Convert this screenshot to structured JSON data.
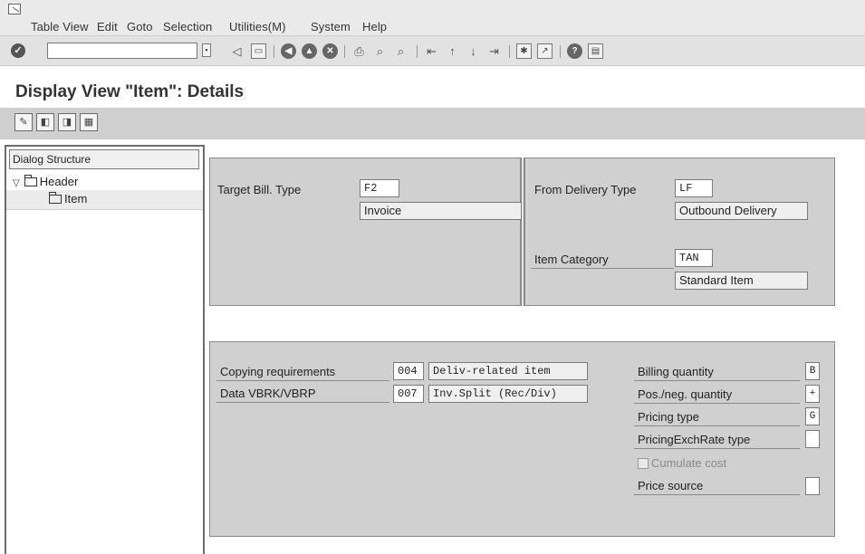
{
  "menu": {
    "items": [
      "Table View",
      "Edit",
      "Goto",
      "Selection",
      "Utilities(M)",
      "System",
      "Help"
    ]
  },
  "toolbar": {
    "command_field_value": "",
    "icons": [
      "enter-icon",
      "command-history-icon",
      "back-icon",
      "save-icon",
      "back-round-icon",
      "exit-icon",
      "cancel-icon",
      "print-icon",
      "find-icon",
      "find-next-icon",
      "first-page-icon",
      "previous-page-icon",
      "next-page-icon",
      "last-page-icon",
      "create-session-icon",
      "create-shortcut-icon",
      "help-icon",
      "layout-menu-icon"
    ]
  },
  "page": {
    "title": "Display View \"Item\": Details"
  },
  "app_toolbar": {
    "icons": [
      "display-change-icon",
      "previous-entry-icon",
      "next-entry-icon",
      "variable-list-icon"
    ]
  },
  "dialog_structure": {
    "header": "Dialog Structure",
    "nodes": [
      {
        "label": "Header",
        "expanded": true
      },
      {
        "label": "Item",
        "selected": true
      }
    ]
  },
  "copy_control": {
    "target_bill_type": {
      "label": "Target Bill. Type",
      "value": "F2",
      "description": "Invoice"
    },
    "from_delivery_type": {
      "label": "From Delivery Type",
      "value": "LF",
      "description": "Outbound Delivery"
    },
    "item_category": {
      "label": "Item Category",
      "value": "TAN",
      "description": "Standard Item"
    }
  },
  "details": {
    "copying_requirements": {
      "label": "Copying requirements",
      "value": "004",
      "description": "Deliv-related item"
    },
    "data_vbrk_vbrp": {
      "label": "Data VBRK/VBRP",
      "value": "007",
      "description": "Inv.Split (Rec/Div)"
    },
    "billing_quantity": {
      "label": "Billing quantity",
      "value": "B"
    },
    "pos_neg_quantity": {
      "label": "Pos./neg. quantity",
      "value": "+"
    },
    "pricing_type": {
      "label": "Pricing type",
      "value": "G"
    },
    "pricing_exch_rate_type": {
      "label": "PricingExchRate type",
      "value": ""
    },
    "cumulate_cost": {
      "label": "Cumulate cost",
      "checked": false
    },
    "price_source": {
      "label": "Price source",
      "value": ""
    }
  }
}
